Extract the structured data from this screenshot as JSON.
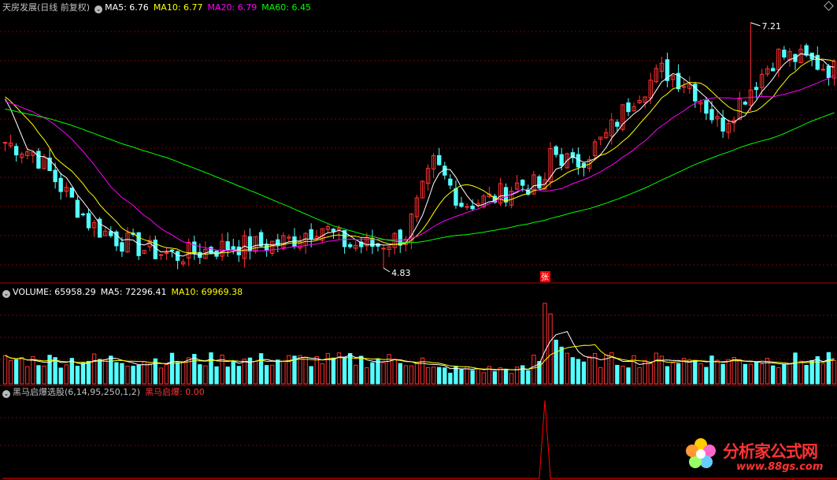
{
  "price_header": {
    "title": "天房发展(日线 前复权)",
    "ma5": "MA5: 6.76",
    "ma10": "MA10: 6.77",
    "ma20": "MA20: 6.79",
    "ma60": "MA60: 6.45"
  },
  "volume_header": {
    "volume": "VOLUME: 65958.29",
    "ma5": "MA5: 72296.41",
    "ma10": "MA10: 69969.38"
  },
  "indicator_header": {
    "name": "黑马启爆选股(6,14,95,250,1,2)",
    "value": "黑马启爆: 0.00"
  },
  "annotations": {
    "high_label": "7.21",
    "low_label": "4.83",
    "zhang_marker": "张"
  },
  "logo": {
    "text": "分析家公式网",
    "url": "www.88gs.com"
  },
  "colors": {
    "up": "#ff3232",
    "down": "#54ffff",
    "ma5": "#ffffff",
    "ma10": "#ffff00",
    "ma20": "#ff00ff",
    "ma60": "#00ff00",
    "grid": "#7a0000",
    "signal": "#ff0000"
  },
  "chart_data": [
    {
      "type": "candlestick",
      "title": "天房发展(日线 前复权)",
      "ylim": [
        4.7,
        7.3
      ],
      "extremes": {
        "high": 7.21,
        "low": 4.83
      },
      "series_names": [
        "MA5",
        "MA10",
        "MA20",
        "MA60"
      ],
      "last_values": {
        "MA5": 6.76,
        "MA10": 6.77,
        "MA20": 6.79,
        "MA60": 6.45
      },
      "keypoints": [
        6.05,
        5.95,
        5.6,
        5.25,
        5.1,
        5.0,
        4.95,
        5.0,
        5.05,
        5.05,
        5.1,
        5.25,
        5.05,
        5.05,
        5.15,
        5.85,
        5.45,
        5.5,
        5.65,
        5.6,
        5.85,
        6.1,
        6.5,
        6.75,
        6.6,
        6.2,
        6.55,
        6.9,
        6.85,
        6.75
      ]
    },
    {
      "type": "bar",
      "title": "VOLUME",
      "last_values": {
        "VOLUME": 65958.29,
        "MA5": 72296.41,
        "MA10": 69969.38
      }
    },
    {
      "type": "line",
      "title": "黑马启爆选股(6,14,95,250,1,2)",
      "series_names": [
        "黑马启爆"
      ],
      "last_value": 0.0,
      "signal_bar_index": 97
    }
  ]
}
